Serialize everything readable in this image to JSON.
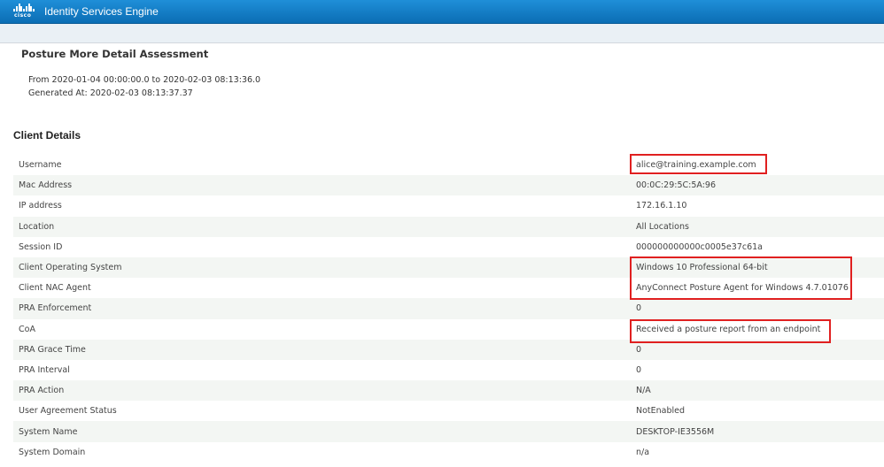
{
  "app": {
    "brand": "cisco",
    "title": "Identity Services Engine",
    "header_color": "#0b6db4"
  },
  "report": {
    "title": "Posture More Detail Assessment",
    "range": "From 2020-01-04 00:00:00.0 to 2020-02-03 08:13:36.0",
    "generated": "Generated At: 2020-02-03 08:13:37.37"
  },
  "client_details": {
    "section_title": "Client Details",
    "rows": [
      {
        "label": "Username",
        "value": "alice@training.example.com"
      },
      {
        "label": "Mac Address",
        "value": "00:0C:29:5C:5A:96"
      },
      {
        "label": "IP address",
        "value": "172.16.1.10"
      },
      {
        "label": "Location",
        "value": "All Locations"
      },
      {
        "label": "Session ID",
        "value": "000000000000c0005e37c61a"
      },
      {
        "label": "Client Operating System",
        "value": "Windows 10 Professional 64-bit"
      },
      {
        "label": "Client NAC Agent",
        "value": "AnyConnect Posture Agent for Windows 4.7.01076"
      },
      {
        "label": "PRA Enforcement",
        "value": "0"
      },
      {
        "label": "CoA",
        "value": "Received a posture report from an endpoint"
      },
      {
        "label": "PRA Grace Time",
        "value": "0"
      },
      {
        "label": "PRA Interval",
        "value": "0"
      },
      {
        "label": "PRA Action",
        "value": "N/A"
      },
      {
        "label": "User Agreement Status",
        "value": "NotEnabled"
      },
      {
        "label": "System Name",
        "value": "DESKTOP-IE3556M"
      },
      {
        "label": "System Domain",
        "value": "n/a"
      }
    ]
  },
  "highlight_color": "#e02020"
}
